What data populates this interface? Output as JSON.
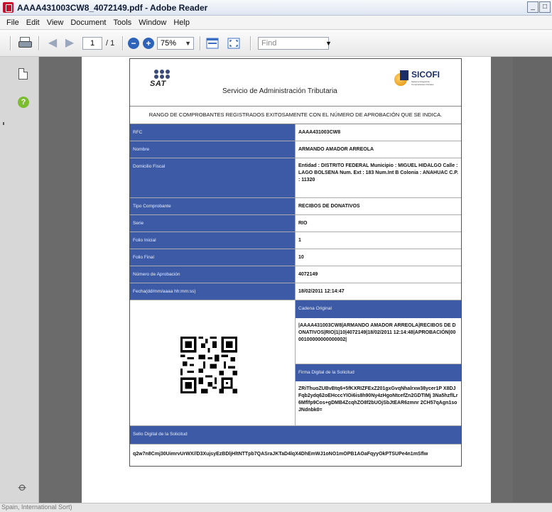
{
  "window": {
    "title": "AAAA431003CW8_4072149.pdf - Adobe Reader",
    "controls": [
      "_",
      "□"
    ]
  },
  "menu": [
    "File",
    "Edit",
    "View",
    "Document",
    "Tools",
    "Window",
    "Help"
  ],
  "toolbar": {
    "page_current": "1",
    "page_total": "/ 1",
    "zoom_out": "−",
    "zoom_in": "+",
    "zoom_value": "75%",
    "find_placeholder": "Find"
  },
  "document": {
    "header": {
      "sat_logo": "SAT",
      "subtitle": "Servicio de Administración Tributaria",
      "sicofi_logo": "SICOFI",
      "sicofi_tagline": "Sistema Integral de Comprobantes Fiscales"
    },
    "rango": "RANGO DE COMPROBANTES REGISTRADOS EXITOSAMENTE CON EL NÚMERO DE APROBACIÓN QUE SE INDICA.",
    "rows": [
      {
        "label": "RFC",
        "value": "AAAA431003CW8"
      },
      {
        "label": "Nombre",
        "value": "ARMANDO AMADOR ARREOLA"
      },
      {
        "label": "Domicilio Fiscal",
        "value": "Entidad : DISTRITO FEDERAL Municipio : MIGUEL HIDALGO Calle : LAGO BOLSENA Num. Ext : 183 Num.Int B Colonia : ANAHUAC C.P. : 11320"
      },
      {
        "label": "Tipo Comprobante",
        "value": "RECIBOS DE DONATIVOS"
      },
      {
        "label": "Serie",
        "value": "RIO"
      },
      {
        "label": "Folio Inicial",
        "value": "1"
      },
      {
        "label": "Folio Final",
        "value": "10"
      },
      {
        "label": "Número de Aprobación",
        "value": "4072149"
      },
      {
        "label": "Fecha(dd/mm/aaaa hh:mm:ss)",
        "value": "18/02/2011 12:14:47"
      }
    ],
    "cadena_label": "Cadena Original",
    "cadena_value": "|AAAA431003CW8|ARMANDO AMADOR ARREOLA|RECIBOS DE DONATIVOS|RIO|1|10|4072149|18/02/2011 12:14:48|APROBACIÓN|0000100000000000002|",
    "firma_label": "Firma Digital de la Solicitud",
    "firma_value": "ZRiThuoZUBvBtq6+5fKXRIZFExZ201gxGvqNhalrxw38ycer1P X8DJFqb2ydq62oEHcccYIOi6is8h90Ny4zHgoNtcefZn2GDTIMj 3Na5hzflLr6Mflfp9Cos+gDMB4ZcqhZO8f2bUOjSbJtEAR6zmnr 2CH57qAgn1soJNdnbk0=",
    "sello_label": "Sello Digital de la Solicitud",
    "sello_value": "q2w7n8Cmj30UimrvUrWX//D3XujsyEzBDljHltNTTpb7QASraJKTaD4lqX4DhEmWJ1oNO1mOPB1AOaFqyyOkPTSUPe4n1mSflw"
  },
  "status": {
    "text": "Spain, International Sort)"
  }
}
